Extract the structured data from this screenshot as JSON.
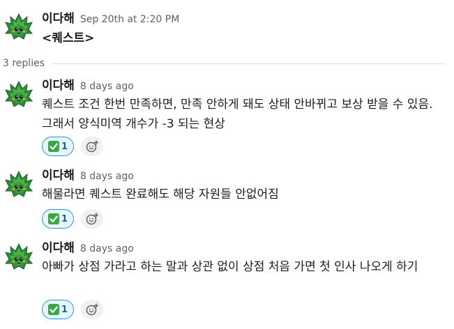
{
  "messages": [
    {
      "author": "이다해",
      "time": "Sep 20th at 2:20 PM",
      "text": "<퀘스트>"
    },
    {
      "author": "이다해",
      "time": "8 days ago",
      "text": "퀘스트 조건 한번 만족하면, 만족 안하게 돼도 상태 안바뀌고 보상 받을 수 있음. 그래서 양식미역 개수가 -3 되는 현상",
      "reaction": {
        "emoji": "✅",
        "count": "1"
      }
    },
    {
      "author": "이다해",
      "time": "8 days ago",
      "text": "해물라면 퀘스트 완료해도 해당 자원들 안없어짐",
      "reaction": {
        "emoji": "✅",
        "count": "1"
      }
    },
    {
      "author": "이다해",
      "time": "8 days ago",
      "text": "아빠가 상점 가라고 하는 말과 상관 없이 상점 처음 가면 첫 인사 나오게 하기",
      "reaction": {
        "emoji": "✅",
        "count": "1"
      }
    }
  ],
  "thread": {
    "replies_label": "3 replies"
  },
  "icons": {
    "avatar": "green-leaf-creature-avatar",
    "reaction": "white-check-mark-icon",
    "add_reaction": "add-reaction-icon"
  },
  "colors": {
    "accent": "#1d9bd1",
    "reaction_bg": "#e8f5fa",
    "reaction_count": "#1264a3",
    "muted_text": "#616061"
  }
}
